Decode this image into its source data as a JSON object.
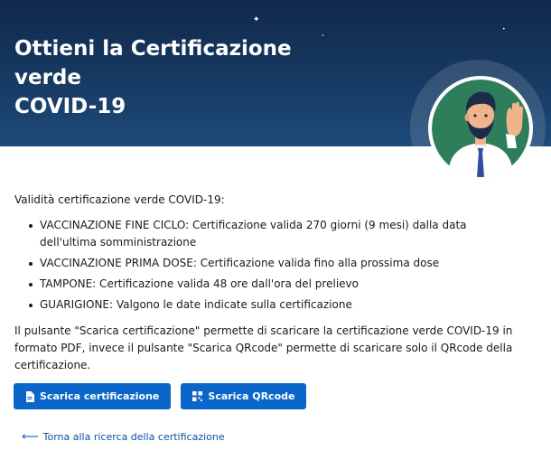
{
  "hero": {
    "title_line1": "Ottieni la Certificazione verde",
    "title_line2": "COVID-19",
    "illustration": "waving-man-avatar"
  },
  "content": {
    "intro": "Validità certificazione verde COVID-19:",
    "rules": [
      "VACCINAZIONE FINE CICLO: Certificazione valida 270 giorni (9 mesi) dalla data dell'ultima somministrazione",
      "VACCINAZIONE PRIMA DOSE: Certificazione valida fino alla prossima dose",
      "TAMPONE: Certificazione valida 48 ore dall'ora del prelievo",
      "GUARIGIONE: Valgono le date indicate sulla certificazione"
    ],
    "description": "Il pulsante \"Scarica certificazione\" permette di scaricare la certificazione verde COVID-19 in formato PDF, invece il pulsante \"Scarica QRcode\" permette di scaricare solo il QRcode della certificazione."
  },
  "buttons": {
    "download_certificate": {
      "label": "Scarica certificazione",
      "icon": "document-icon"
    },
    "download_qrcode": {
      "label": "Scarica QRcode",
      "icon": "qrcode-icon"
    }
  },
  "back_link": {
    "label": "Torna alla ricerca della certificazione",
    "icon": "arrow-left-icon"
  },
  "colors": {
    "hero_bg": "#173a63",
    "primary": "#0a66c8",
    "link": "#0a4f9e",
    "avatar_bg": "#2e7d5b"
  }
}
